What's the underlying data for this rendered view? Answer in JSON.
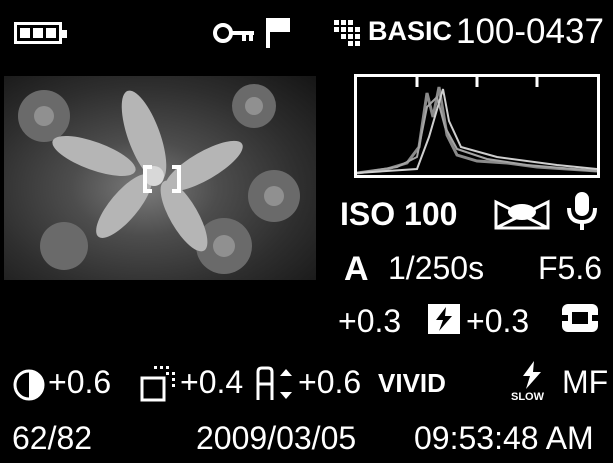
{
  "status_bar": {
    "battery_icon": "battery-full-icon",
    "protect_icon": "key-icon",
    "flag_icon": "flag-icon",
    "quality_icon": "image-quality-grid-icon",
    "quality_label": "BASIC",
    "file_number": "100-0437"
  },
  "exposure": {
    "iso": "ISO 100",
    "metering_icon": "metering-mode-icon",
    "voice_memo_icon": "microphone-icon",
    "mode": "A",
    "shutter": "1/250s",
    "aperture": "F5.6",
    "exposure_comp": "+0.3",
    "flash_comp_icon": "flash-compensation-icon",
    "flash_comp": "+0.3",
    "stabilizer_icon": "image-stabilizer-icon"
  },
  "processing": {
    "contrast_icon": "contrast-icon",
    "contrast": "+0.6",
    "sharpness_icon": "sharpness-icon",
    "sharpness": "+0.4",
    "saturation_icon": "saturation-icon",
    "saturation": "+0.6",
    "color_mode": "VIVID",
    "flash_mode_icon": "flash-slow-sync-icon",
    "flash_mode_label": "SLOW",
    "focus_mode": "MF"
  },
  "footer": {
    "frame_counter": "62/82",
    "date": "2009/03/05",
    "time": "09:53:48 AM"
  }
}
